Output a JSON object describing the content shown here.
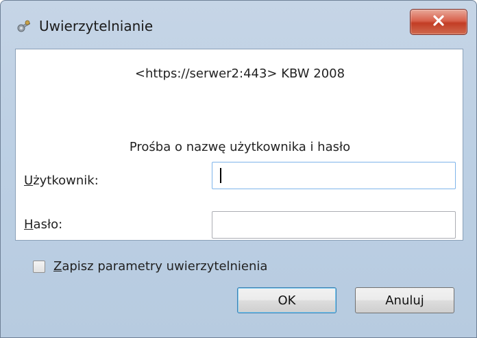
{
  "window": {
    "title": "Uwierzytelnianie",
    "icon": "keys-icon",
    "close_icon": "close-icon"
  },
  "auth": {
    "realm": "<https://serwer2:443> KBW 2008",
    "prompt": "Prośba o nazwę użytkownika i hasło"
  },
  "fields": {
    "username_label_accel": "U",
    "username_label_rest": "żytkownik:",
    "username_value": "",
    "password_label_accel": "H",
    "password_label_rest": "asło:",
    "password_value": ""
  },
  "remember": {
    "label_accel": "Z",
    "label_rest": "apisz parametry uwierzytelnienia",
    "checked": false
  },
  "buttons": {
    "ok": "OK",
    "cancel": "Anuluj"
  },
  "colors": {
    "frame": "#bdd0e4",
    "close_button": "#c23d25",
    "focus_border": "#7eb4ea"
  }
}
